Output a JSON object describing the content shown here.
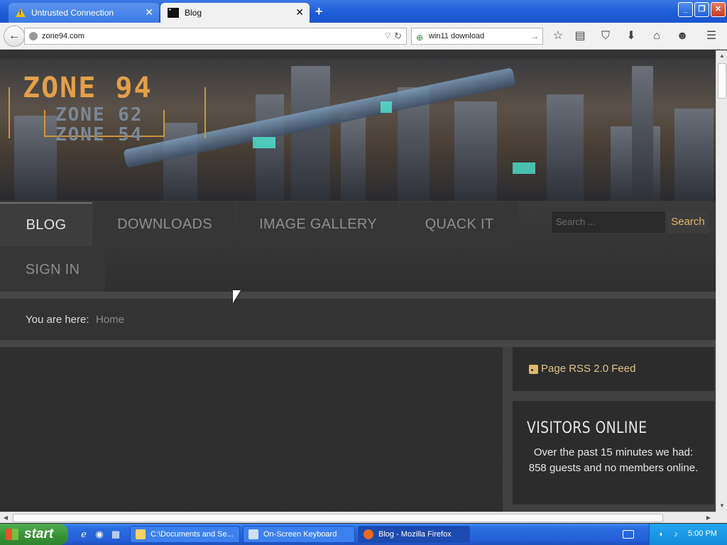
{
  "browser": {
    "tabs": [
      {
        "label": "Untrusted Connection",
        "icon": "warning-icon",
        "active": false
      },
      {
        "label": "Blog",
        "icon": "site-favicon",
        "active": true
      }
    ],
    "new_tab": "+",
    "url": "zone94.com",
    "search_query": "win11 download",
    "toolbar_icons": [
      "bookmark-star-icon",
      "reading-list-icon",
      "pocket-icon",
      "downloads-icon",
      "home-icon",
      "chat-icon",
      "menu-icon"
    ]
  },
  "site": {
    "logo": {
      "main": "ZONE 94",
      "sub1": "ZONE 62",
      "sub2": "ZONE 54"
    },
    "nav": [
      {
        "label": "BLOG",
        "active": true
      },
      {
        "label": "DOWNLOADS",
        "active": false
      },
      {
        "label": "IMAGE GALLERY",
        "active": false
      },
      {
        "label": "QUACK IT",
        "active": false
      },
      {
        "label": "SIGN IN",
        "active": false
      }
    ],
    "search": {
      "placeholder": "Search ...",
      "button": "Search"
    },
    "breadcrumb": {
      "label": "You are here:",
      "current": "Home"
    },
    "sidebar": {
      "rss_label": "Page RSS 2.0 Feed",
      "visitors_title": "VISITORS ONLINE",
      "visitors_text": "Over the past 15 minutes we had: 858 guests and no members online."
    }
  },
  "taskbar": {
    "start_label": "start",
    "tasks": [
      {
        "label": "C:\\Documents and Se...",
        "icon": "folder-icon",
        "active": false
      },
      {
        "label": "On-Screen Keyboard",
        "icon": "keyboard-icon",
        "active": false
      },
      {
        "label": "Blog - Mozilla Firefox",
        "icon": "firefox-icon",
        "active": true
      }
    ],
    "clock": "5:00 PM"
  },
  "colors": {
    "accent_gold": "#e0b86a",
    "page_bg": "#333333",
    "xp_blue": "#245ed6",
    "xp_green": "#3a963a"
  }
}
